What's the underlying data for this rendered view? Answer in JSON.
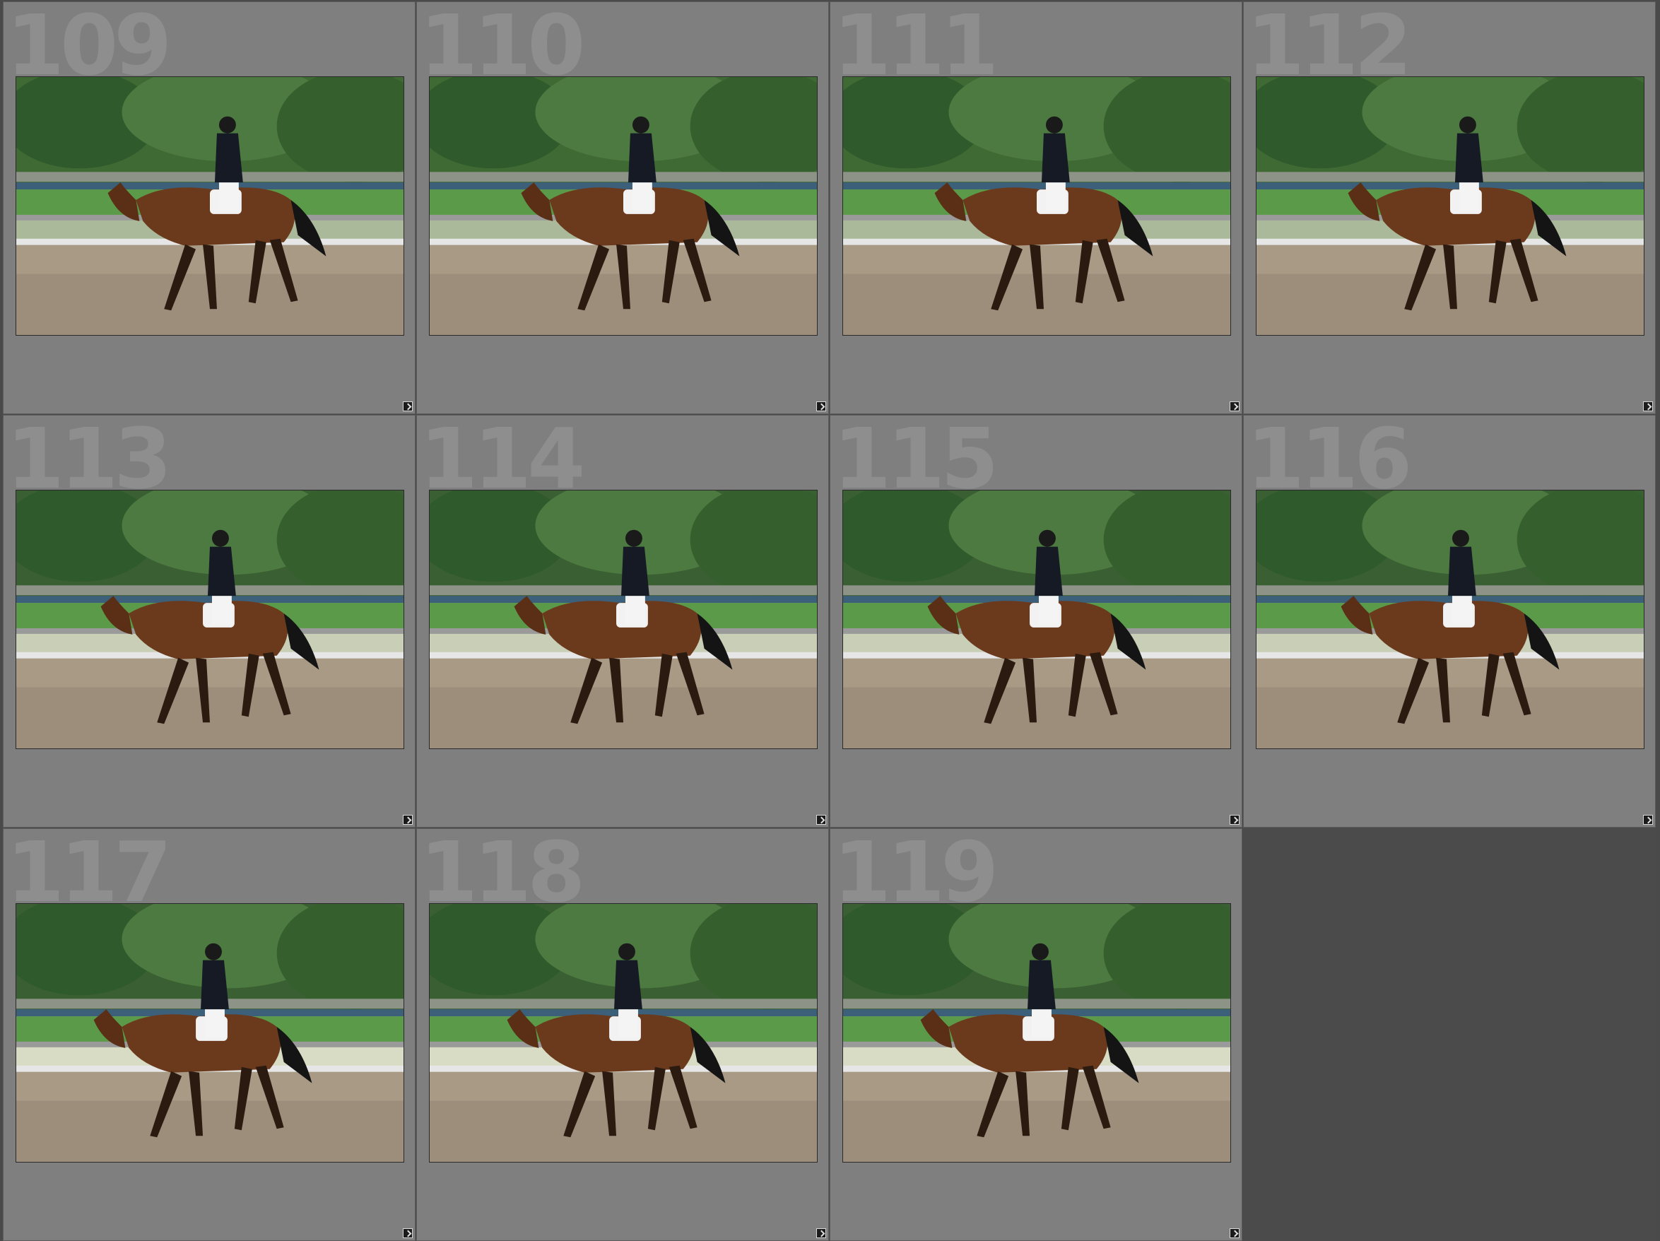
{
  "grid": {
    "cells": [
      {
        "index": "109",
        "photo": "dressage-horse-rider-photo",
        "variant": "a"
      },
      {
        "index": "110",
        "photo": "dressage-horse-rider-photo",
        "variant": "a"
      },
      {
        "index": "111",
        "photo": "dressage-horse-rider-photo",
        "variant": "a"
      },
      {
        "index": "112",
        "photo": "dressage-horse-rider-photo",
        "variant": "a"
      },
      {
        "index": "113",
        "photo": "dressage-horse-rider-photo",
        "variant": "b"
      },
      {
        "index": "114",
        "photo": "dressage-horse-rider-photo",
        "variant": "b"
      },
      {
        "index": "115",
        "photo": "dressage-horse-rider-photo",
        "variant": "b"
      },
      {
        "index": "116",
        "photo": "dressage-horse-rider-photo",
        "variant": "b"
      },
      {
        "index": "117",
        "photo": "dressage-horse-rider-photo",
        "variant": "c"
      },
      {
        "index": "118",
        "photo": "dressage-horse-rider-photo",
        "variant": "c"
      },
      {
        "index": "119",
        "photo": "dressage-horse-rider-photo",
        "variant": "c"
      }
    ],
    "badge_icon": "edited-badge-icon"
  },
  "colors": {
    "cell_bg": "#7f7f7f",
    "index_text": "#8e8e8e",
    "empty_bg": "#4b4b4b"
  }
}
